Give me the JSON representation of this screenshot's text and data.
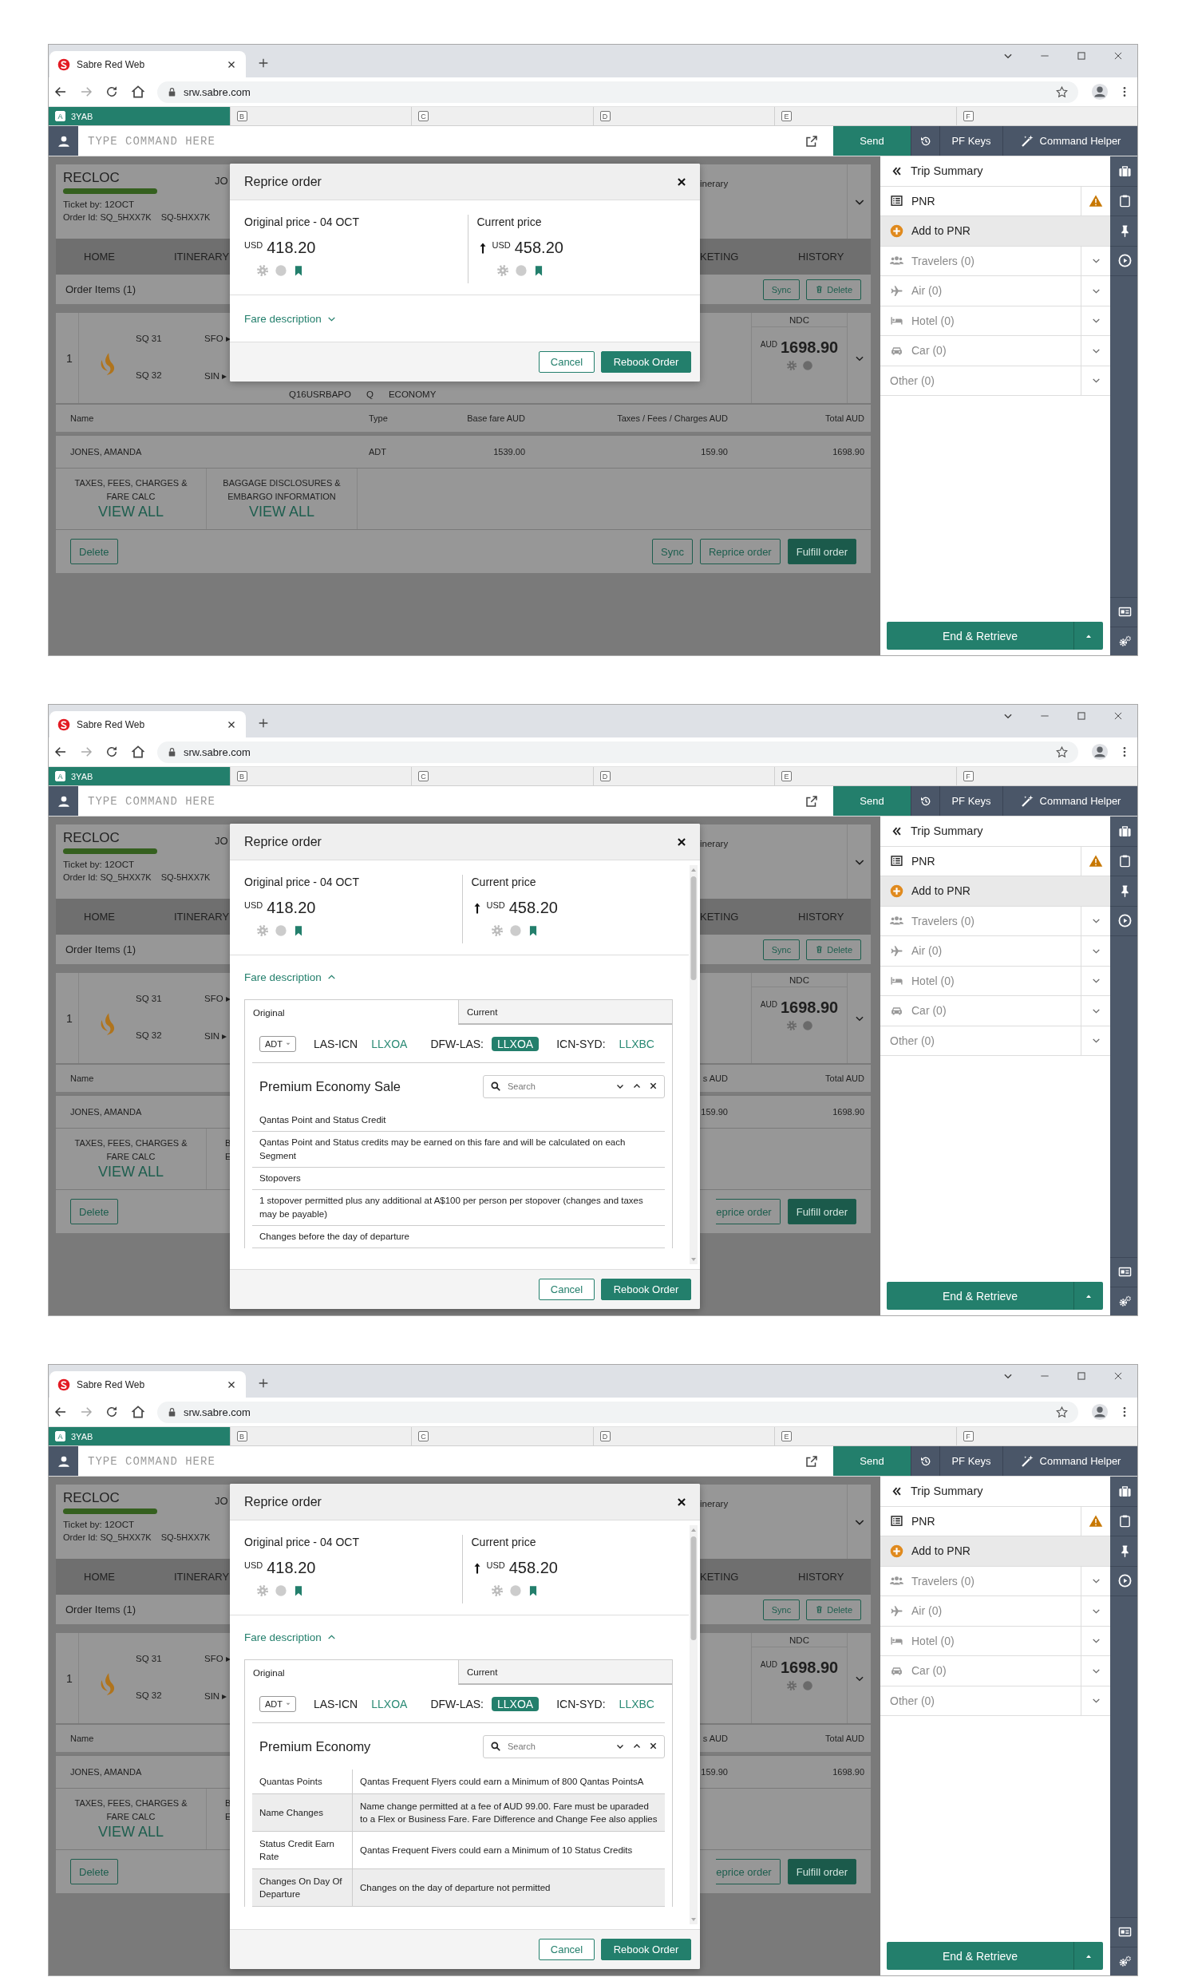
{
  "screens": [
    {
      "browser": {
        "tab_title": "Sabre Red Web",
        "url": "srw.sabre.com"
      },
      "sessions": [
        {
          "letter": "A",
          "label": "3YAB",
          "selected": true
        },
        {
          "letter": "B",
          "selected": false
        },
        {
          "letter": "C",
          "selected": false
        },
        {
          "letter": "D",
          "selected": false
        },
        {
          "letter": "E",
          "selected": false
        },
        {
          "letter": "F",
          "selected": false
        }
      ],
      "command": {
        "placeholder": "TYPE COMMAND HERE",
        "send": "Send",
        "pf_keys": "PF Keys",
        "helper": "Command Helper"
      },
      "order": {
        "recloc": "RECLOC",
        "ticket_by": "Ticket by: 12OCT",
        "order_id": "Order Id: SQ_5HXX7K",
        "order_ref": "SQ-5HXX7K",
        "name_fragment": "JO",
        "itinerary_fragment": "inerary",
        "tabs": [
          "HOME",
          "ITINERARY",
          "KETING",
          "HISTORY"
        ],
        "items_title": "Order Items (1)",
        "items_actions": [
          "Sync",
          "Delete"
        ],
        "segment": {
          "number": "1",
          "legs": [
            {
              "flight": "SQ 31",
              "route": "SFO ▸"
            },
            {
              "flight": "SQ 32",
              "route": "SIN ▸"
            }
          ],
          "fare_basis": "Q16USRBAPO",
          "booking_class": "Q",
          "cabin": "ECONOMY",
          "source": "NDC",
          "currency": "AUD",
          "total": "1698.90"
        },
        "columns": {
          "name": "Name",
          "type": "Type",
          "base_fare": "Base fare AUD",
          "taxes": "Taxes / Fees / Charges AUD",
          "total": "Total AUD"
        },
        "passengers": [
          {
            "name": "JONES, AMANDA",
            "type": "ADT",
            "base_fare": "1539.00",
            "taxes": "159.90",
            "total": "1698.90"
          }
        ],
        "links": [
          {
            "title": "TAXES, FEES, CHARGES & FARE CALC",
            "action": "VIEW ALL"
          },
          {
            "title": "BAGGAGE DISCLOSURES & EMBARGO INFORMATION",
            "action": "VIEW ALL"
          }
        ],
        "footer_buttons": [
          {
            "kind": "delete",
            "label": "Delete"
          },
          {
            "kind": "sync",
            "label": "Sync"
          },
          {
            "kind": "reprice",
            "label": "Reprice order",
            "clipped": false
          },
          {
            "kind": "fulfill",
            "label": "Fulfill order"
          }
        ]
      },
      "modal": {
        "title": "Reprice order",
        "original": {
          "label": "Original price - 04 OCT",
          "currency": "USD",
          "amount": "418.20"
        },
        "current": {
          "label": "Current price",
          "currency": "USD",
          "amount": "458.20",
          "trend_up": true
        },
        "fare_description": {
          "label": "Fare description",
          "expanded": false
        },
        "buttons": {
          "cancel": "Cancel",
          "confirm": "Rebook Order"
        }
      },
      "panel": {
        "title": "Trip Summary",
        "items": [
          {
            "kind": "pnr",
            "label": "PNR",
            "alert": true,
            "selected": false,
            "disabled": false
          },
          {
            "kind": "add",
            "label": "Add to PNR",
            "selected": true,
            "disabled": false
          },
          {
            "kind": "travelers",
            "label": "Travelers (0)",
            "selected": false,
            "disabled": true,
            "expanded": false
          },
          {
            "kind": "air",
            "label": "Air (0)",
            "selected": false,
            "disabled": true,
            "expanded": false
          },
          {
            "kind": "hotel",
            "label": "Hotel (0)",
            "selected": false,
            "disabled": true,
            "expanded": false
          },
          {
            "kind": "car",
            "label": "Car (0)",
            "selected": false,
            "disabled": true,
            "expanded": false
          },
          {
            "kind": "other",
            "label": "Other (0)",
            "selected": false,
            "disabled": true,
            "expanded": false
          }
        ],
        "end_button": "End & Retrieve"
      }
    },
    {
      "browser": {
        "tab_title": "Sabre Red Web",
        "url": "srw.sabre.com"
      },
      "sessions": [
        {
          "letter": "A",
          "label": "3YAB",
          "selected": true
        },
        {
          "letter": "B",
          "selected": false
        },
        {
          "letter": "C",
          "selected": false
        },
        {
          "letter": "D",
          "selected": false
        },
        {
          "letter": "E",
          "selected": false
        },
        {
          "letter": "F",
          "selected": false
        }
      ],
      "command": {
        "placeholder": "TYPE COMMAND HERE",
        "send": "Send",
        "pf_keys": "PF Keys",
        "helper": "Command Helper"
      },
      "order": {
        "recloc": "RECLOC",
        "ticket_by": "Ticket by: 12OCT",
        "order_id": "Order Id: SQ_5HXX7K",
        "order_ref": "SQ-5HXX7K",
        "name_fragment": "JO",
        "itinerary_fragment": "inerary",
        "tabs": [
          "HOME",
          "ITINERARY",
          "KETING",
          "HISTORY"
        ],
        "items_title": "Order Items (1)",
        "items_actions": [
          "Sync",
          "Delete"
        ],
        "segment": {
          "number": "1",
          "legs": [
            {
              "flight": "SQ 31",
              "route": "SFO ▸"
            },
            {
              "flight": "SQ 32",
              "route": "SIN ▸"
            }
          ],
          "source": "NDC",
          "currency": "AUD",
          "total": "1698.90"
        },
        "columns": {
          "name": "Name",
          "taxes": "s AUD",
          "total": "Total AUD"
        },
        "passengers": [
          {
            "name": "JONES, AMANDA",
            "taxes": "159.90",
            "total": "1698.90"
          }
        ],
        "links": [
          {
            "title": "TAXES, FEES, CHARGES & FARE CALC",
            "action": "VIEW ALL"
          },
          {
            "title_lines": [
              "B",
              "E"
            ]
          }
        ],
        "footer_buttons": [
          {
            "kind": "delete",
            "label": "Delete"
          },
          {
            "kind": "reprice",
            "label": "eprice order",
            "clipped": true
          },
          {
            "kind": "fulfill",
            "label": "Fulfill order"
          }
        ]
      },
      "modal": {
        "title": "Reprice order",
        "original": {
          "label": "Original price - 04 OCT",
          "currency": "USD",
          "amount": "418.20"
        },
        "current": {
          "label": "Current price",
          "currency": "USD",
          "amount": "458.20",
          "trend_up": true
        },
        "fare_description": {
          "label": "Fare description",
          "expanded": true
        },
        "fare_panel": {
          "tabs": [
            {
              "label": "Original",
              "selected": true
            },
            {
              "label": "Current",
              "selected": false
            }
          ],
          "passenger_type": "ADT",
          "routes": [
            {
              "route": "LAS-ICN",
              "code": "LLXOA",
              "selected": false
            },
            {
              "route": "DFW-LAS:",
              "code": "LLXOA",
              "selected": true
            },
            {
              "route": "ICN-SYD:",
              "code": "LLXBC",
              "selected": false
            }
          ],
          "fare_name": "Premium Economy Sale",
          "search": {
            "placeholder": "Search"
          },
          "rules": [
            {
              "kind": "heading",
              "text": "Qantas Point and Status Credit"
            },
            {
              "kind": "text",
              "text": "Qantas Point and Status credits may be earned on this fare and will be calculated on each Segment"
            },
            {
              "kind": "heading",
              "text": "Stopovers"
            },
            {
              "kind": "text",
              "text": "1 stopover permitted plus any additional at A$100 per person per stopover (changes and taxes may be payable)"
            },
            {
              "kind": "heading",
              "text": "Changes before the day of departure"
            }
          ]
        },
        "buttons": {
          "cancel": "Cancel",
          "confirm": "Rebook Order"
        }
      },
      "panel": {
        "title": "Trip Summary",
        "items": [
          {
            "kind": "pnr",
            "label": "PNR",
            "alert": true,
            "selected": false,
            "disabled": false
          },
          {
            "kind": "add",
            "label": "Add to PNR",
            "selected": true,
            "disabled": false
          },
          {
            "kind": "travelers",
            "label": "Travelers (0)",
            "selected": false,
            "disabled": true,
            "expanded": false
          },
          {
            "kind": "air",
            "label": "Air (0)",
            "selected": false,
            "disabled": true,
            "expanded": false
          },
          {
            "kind": "hotel",
            "label": "Hotel (0)",
            "selected": false,
            "disabled": true,
            "expanded": false
          },
          {
            "kind": "car",
            "label": "Car (0)",
            "selected": false,
            "disabled": true,
            "expanded": false
          },
          {
            "kind": "other",
            "label": "Other (0)",
            "selected": false,
            "disabled": true,
            "expanded": false
          }
        ],
        "end_button": "End & Retrieve"
      }
    },
    {
      "browser": {
        "tab_title": "Sabre Red Web",
        "url": "srw.sabre.com"
      },
      "sessions": [
        {
          "letter": "A",
          "label": "3YAB",
          "selected": true
        },
        {
          "letter": "B",
          "selected": false
        },
        {
          "letter": "C",
          "selected": false
        },
        {
          "letter": "D",
          "selected": false
        },
        {
          "letter": "E",
          "selected": false
        },
        {
          "letter": "F",
          "selected": false
        }
      ],
      "command": {
        "placeholder": "TYPE COMMAND HERE",
        "send": "Send",
        "pf_keys": "PF Keys",
        "helper": "Command Helper"
      },
      "order": {
        "recloc": "RECLOC",
        "ticket_by": "Ticket by: 12OCT",
        "order_id": "Order Id: SQ_5HXX7K",
        "order_ref": "SQ-5HXX7K",
        "name_fragment": "JO",
        "itinerary_fragment": "inerary",
        "tabs": [
          "HOME",
          "ITINERARY",
          "KETING",
          "HISTORY"
        ],
        "items_title": "Order Items (1)",
        "items_actions": [
          "Sync",
          "Delete"
        ],
        "segment": {
          "number": "1",
          "legs": [
            {
              "flight": "SQ 31",
              "route": "SFO ▸"
            },
            {
              "flight": "SQ 32",
              "route": "SIN ▸"
            }
          ],
          "source": "NDC",
          "currency": "AUD",
          "total": "1698.90"
        },
        "columns": {
          "name": "Name",
          "taxes": "s AUD",
          "total": "Total AUD"
        },
        "passengers": [
          {
            "name": "JONES, AMANDA",
            "taxes": "159.90",
            "total": "1698.90"
          }
        ],
        "links": [
          {
            "title": "TAXES, FEES, CHARGES & FARE CALC",
            "action": "VIEW ALL"
          },
          {
            "title_lines": [
              "B",
              "E"
            ]
          }
        ],
        "footer_buttons": [
          {
            "kind": "delete",
            "label": "Delete"
          },
          {
            "kind": "reprice",
            "label": "eprice order",
            "clipped": true
          },
          {
            "kind": "fulfill",
            "label": "Fulfill order"
          }
        ]
      },
      "modal": {
        "title": "Reprice order",
        "original": {
          "label": "Original price - 04 OCT",
          "currency": "USD",
          "amount": "418.20"
        },
        "current": {
          "label": "Current price",
          "currency": "USD",
          "amount": "458.20",
          "trend_up": true
        },
        "fare_description": {
          "label": "Fare description",
          "expanded": true
        },
        "fare_panel": {
          "tabs": [
            {
              "label": "Original",
              "selected": true
            },
            {
              "label": "Current",
              "selected": false
            }
          ],
          "passenger_type": "ADT",
          "routes": [
            {
              "route": "LAS-ICN",
              "code": "LLXOA",
              "selected": false
            },
            {
              "route": "DFW-LAS:",
              "code": "LLXOA",
              "selected": true
            },
            {
              "route": "ICN-SYD:",
              "code": "LLXBC",
              "selected": false
            }
          ],
          "fare_name": "Premium Economy",
          "search": {
            "placeholder": "Search"
          },
          "rules": [
            {
              "kind": "row",
              "label": "Quantas Points",
              "text": "Qantas Frequent Flyers could earn a Minimum of 800 Qantas PointsA"
            },
            {
              "kind": "row",
              "label": "Name Changes",
              "text": "Name change permitted at a fee of AUD 99.00. Fare must be uparaded to a Flex or Business Fare. Fare Difference and Change Fee also applies"
            },
            {
              "kind": "row",
              "label": "Status Credit Earn Rate",
              "text": "Qantas Frequent Fivers could earn a Minimum of 10 Status Credits"
            },
            {
              "kind": "row",
              "label": "Changes On Day Of Departure",
              "text": "Changes on the day of departure not permitted"
            }
          ]
        },
        "buttons": {
          "cancel": "Cancel",
          "confirm": "Rebook Order"
        }
      },
      "panel": {
        "title": "Trip Summary",
        "items": [
          {
            "kind": "pnr",
            "label": "PNR",
            "alert": true,
            "selected": false,
            "disabled": false
          },
          {
            "kind": "add",
            "label": "Add to PNR",
            "selected": true,
            "disabled": false
          },
          {
            "kind": "travelers",
            "label": "Travelers (0)",
            "selected": false,
            "disabled": true,
            "expanded": false
          },
          {
            "kind": "air",
            "label": "Air (0)",
            "selected": false,
            "disabled": true,
            "expanded": false
          },
          {
            "kind": "hotel",
            "label": "Hotel (0)",
            "selected": false,
            "disabled": true,
            "expanded": false
          },
          {
            "kind": "car",
            "label": "Car (0)",
            "selected": false,
            "disabled": true,
            "expanded": false
          },
          {
            "kind": "other",
            "label": "Other (0)",
            "selected": false,
            "disabled": true,
            "expanded": false
          }
        ],
        "end_button": "End & Retrieve"
      }
    }
  ]
}
